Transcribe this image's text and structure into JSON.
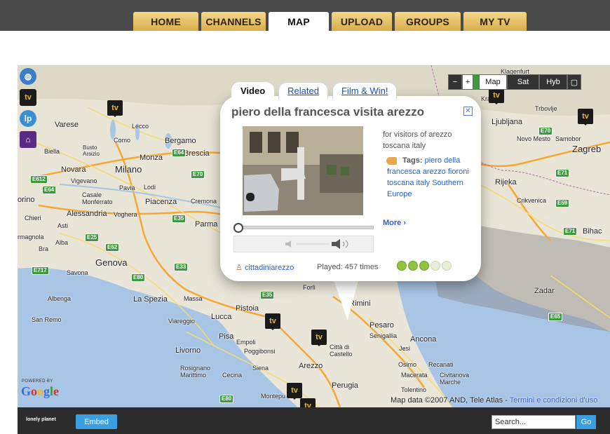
{
  "nav": {
    "tabs": [
      {
        "label": "HOME"
      },
      {
        "label": "CHANNELS"
      },
      {
        "label": "MAP"
      },
      {
        "label": "UPLOAD"
      },
      {
        "label": "GROUPS"
      },
      {
        "label": "MY TV"
      }
    ],
    "active": "MAP"
  },
  "map_controls": {
    "zoom_out": "−",
    "zoom_in": "+",
    "types": [
      "Map",
      "Sat",
      "Hyb"
    ],
    "active_type": "Map"
  },
  "map_labels": {
    "varese": "Varese",
    "bergamo": "Bergamo",
    "brescia": "Brescia",
    "como": "Como",
    "lecco": "Lecco",
    "monza": "Monza",
    "biella": "Biella",
    "busto": "Busto\nArsizio",
    "milano": "Milano",
    "novara": "Novara",
    "vigevano": "Vigevano",
    "pavia": "Pavia",
    "lodi": "Lodi",
    "casale": "Casale\nMonferrato",
    "piacenza": "Piacenza",
    "cremona": "Cremona",
    "alessandria": "Alessandria",
    "voghera": "Voghera",
    "asti": "Asti",
    "parma": "Parma",
    "alba": "Alba",
    "bra": "Bra",
    "genova": "Genova",
    "savona": "Savona",
    "albenga": "Albenga",
    "sanremo": "San Remo",
    "laspezia": "La Spezia",
    "massa": "Massa",
    "viareggio": "Viareggio",
    "lucca": "Lucca",
    "pistoia": "Pistoia",
    "pisa": "Pisa",
    "livorno": "Livorno",
    "empoli": "Empoli",
    "poggibonsi": "Poggibonsi",
    "siena": "Siena",
    "arezzo": "Arezzo",
    "rosignano": "Rosignano\nMarittimo",
    "cecina": "Cecina",
    "montepulciano": "Montepu",
    "perugia": "Perugia",
    "forli": "Forlì",
    "rimini": "Rimini",
    "pesaro": "Pesaro",
    "senigallia": "Senigallia",
    "ancona": "Ancona",
    "jesi": "Jesi",
    "osimo": "Osimo",
    "recanati": "Recanati",
    "macerata": "Macerata",
    "civitanova": "Civitanova\nMarche",
    "tolentino": "Tolentino",
    "citta": "Città di\nCastello",
    "ljubljana": "Ljubljana",
    "novomesto": "Novo Mesto",
    "samobor": "Samobor",
    "zagreb": "Zagreb",
    "rijeka": "Rijeka",
    "crikvenica": "Crikvenica",
    "zadar": "Zadar",
    "bihac": "Bihac",
    "trbovlje": "Trbovlje",
    "kranj": "Kran",
    "klagenfurt": "Klagenfurt",
    "orino": "orino",
    "chieri": "Chieri",
    "magnola": "rmagnola"
  },
  "popup": {
    "tabs": [
      "Video",
      "Related",
      "Film & Win!"
    ],
    "active_tab": "Video",
    "title": "piero della francesca visita arezzo",
    "description": "for visitors of arezzo toscana italy",
    "tags_label": "Tags:",
    "tags": "piero della francesca arezzo fioroni toscana italy Southern Europe",
    "more": "More ›",
    "user": "cittadiniarezzo",
    "played": "Played: 457 times",
    "rating": {
      "value": 3,
      "max": 5
    }
  },
  "map_footer": {
    "powered_by": "POWERED BY",
    "google": "Google",
    "data": "Map data ©2007 AND, Tele Atlas - ",
    "terms": "Termini e condizioni d'uso"
  },
  "bottom": {
    "logo": "lonely planet",
    "embed": "Embed",
    "search_value": "Search...",
    "go": "Go"
  },
  "colors": {
    "tab_gold": "#e3bb5e",
    "topbar": "#4a4a4a",
    "bottombar": "#2c2c2c",
    "link_blue": "#2a62c9",
    "button_blue": "#3a9ee0",
    "rating_green": "#8fc43c"
  }
}
